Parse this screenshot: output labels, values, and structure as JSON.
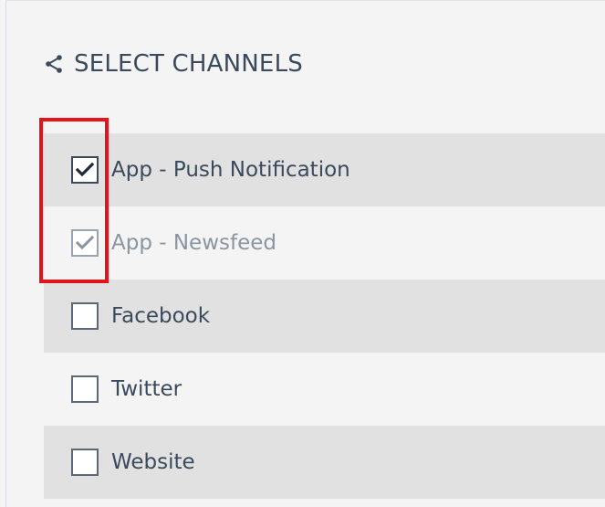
{
  "header": {
    "title": "SELECT CHANNELS",
    "icon": "share-icon"
  },
  "channels": [
    {
      "label": "App - Push Notification",
      "checked": true,
      "enabled": true
    },
    {
      "label": "App - Newsfeed",
      "checked": true,
      "enabled": false
    },
    {
      "label": "Facebook",
      "checked": false,
      "enabled": true
    },
    {
      "label": "Twitter",
      "checked": false,
      "enabled": true
    },
    {
      "label": "Website",
      "checked": false,
      "enabled": true
    }
  ],
  "colors": {
    "text": "#3a4a5c",
    "row_shaded": "#e1e1e1",
    "background": "#f4f4f4",
    "highlight": "#e2141b"
  }
}
